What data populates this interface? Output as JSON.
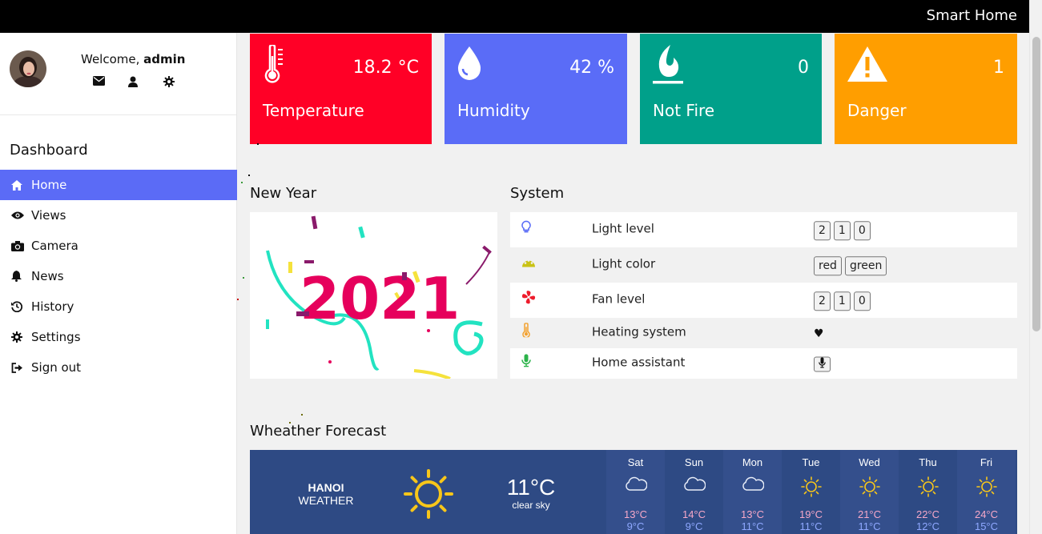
{
  "app": {
    "title": "Smart Home"
  },
  "user": {
    "welcome_prefix": "Welcome,",
    "name": "admin"
  },
  "sidebar": {
    "heading": "Dashboard",
    "items": [
      {
        "label": "Home",
        "icon": "home-icon",
        "active": true
      },
      {
        "label": "Views",
        "icon": "eye-icon"
      },
      {
        "label": "Camera",
        "icon": "camera-icon"
      },
      {
        "label": "News",
        "icon": "bell-icon"
      },
      {
        "label": "History",
        "icon": "history-icon"
      },
      {
        "label": "Settings",
        "icon": "gear-icon"
      },
      {
        "label": "Sign out",
        "icon": "sign-out-icon"
      }
    ]
  },
  "cards": [
    {
      "label": "Temperature",
      "value": "18.2 °C",
      "color": "#ff0026",
      "icon": "thermometer-icon"
    },
    {
      "label": "Humidity",
      "value": "42 %",
      "color": "#5a6cf7",
      "icon": "water-drop-icon"
    },
    {
      "label": "Not Fire",
      "value": "0",
      "color": "#00a08a",
      "icon": "fire-icon"
    },
    {
      "label": "Danger",
      "value": "1",
      "color": "#ff9e00",
      "icon": "warning-icon"
    }
  ],
  "sections": {
    "new_year": "New Year",
    "system": "System",
    "weather": "Wheather Forecast"
  },
  "new_year_image": {
    "text": "2021"
  },
  "system": [
    {
      "name": "Light level",
      "icon": "lightbulb-icon",
      "controls": [
        "2",
        "1",
        "0"
      ]
    },
    {
      "name": "Light color",
      "icon": "palette-icon",
      "controls": [
        "red",
        "green"
      ]
    },
    {
      "name": "Fan level",
      "icon": "fan-icon",
      "controls": [
        "2",
        "1",
        "0"
      ]
    },
    {
      "name": "Heating system",
      "icon": "thermometer-icon",
      "value": "♥"
    },
    {
      "name": "Home assistant",
      "icon": "microphone-icon",
      "controls": [
        "🎤"
      ]
    }
  ],
  "weather": {
    "city": "HANOI",
    "sub": "WEATHER",
    "temp": "11°C",
    "desc": "clear sky",
    "days": [
      {
        "day": "Sat",
        "hi": "13°C",
        "lo": "9°C",
        "icon": "cloud-icon"
      },
      {
        "day": "Sun",
        "hi": "14°C",
        "lo": "9°C",
        "icon": "cloud-icon"
      },
      {
        "day": "Mon",
        "hi": "13°C",
        "lo": "11°C",
        "icon": "cloud-icon"
      },
      {
        "day": "Tue",
        "hi": "19°C",
        "lo": "11°C",
        "icon": "sun-icon"
      },
      {
        "day": "Wed",
        "hi": "21°C",
        "lo": "11°C",
        "icon": "sun-icon"
      },
      {
        "day": "Thu",
        "hi": "22°C",
        "lo": "12°C",
        "icon": "sun-icon"
      },
      {
        "day": "Fri",
        "hi": "24°C",
        "lo": "15°C",
        "icon": "sun-icon"
      }
    ]
  }
}
